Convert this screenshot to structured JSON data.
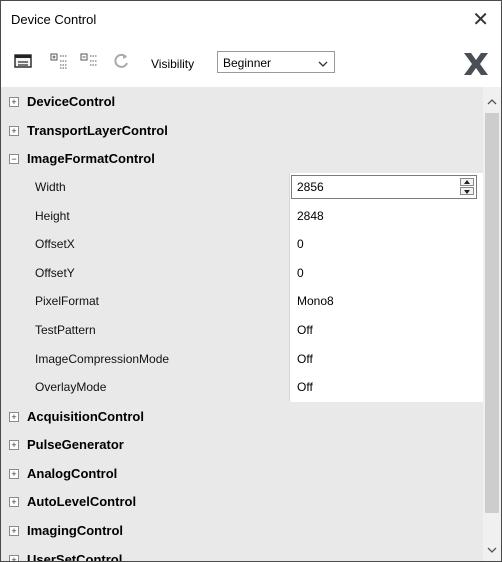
{
  "window": {
    "title": "Device Control"
  },
  "toolbar": {
    "visibility_label": "Visibility",
    "visibility_value": "Beginner"
  },
  "tree": {
    "categories_top": [
      {
        "label": "DeviceControl",
        "expanded": false
      },
      {
        "label": "TransportLayerControl",
        "expanded": false
      },
      {
        "label": "ImageFormatControl",
        "expanded": true
      }
    ],
    "properties": [
      {
        "name": "Width",
        "value": "2856",
        "editing": true
      },
      {
        "name": "Height",
        "value": "2848"
      },
      {
        "name": "OffsetX",
        "value": "0"
      },
      {
        "name": "OffsetY",
        "value": "0"
      },
      {
        "name": "PixelFormat",
        "value": "Mono8"
      },
      {
        "name": "TestPattern",
        "value": "Off"
      },
      {
        "name": "ImageCompressionMode",
        "value": "Off"
      },
      {
        "name": "OverlayMode",
        "value": "Off"
      }
    ],
    "categories_bottom": [
      {
        "label": "AcquisitionControl",
        "expanded": false
      },
      {
        "label": "PulseGenerator",
        "expanded": false
      },
      {
        "label": "AnalogControl",
        "expanded": false
      },
      {
        "label": "AutoLevelControl",
        "expanded": false
      },
      {
        "label": "ImagingControl",
        "expanded": false
      },
      {
        "label": "UserSetControl",
        "expanded": false
      }
    ]
  },
  "icons": {
    "close": "close-icon",
    "tb1": "properties-view-icon",
    "tb2": "expand-all-icon",
    "tb3": "collapse-all-icon",
    "tb4": "refresh-icon",
    "big": "cancel-x-icon"
  }
}
